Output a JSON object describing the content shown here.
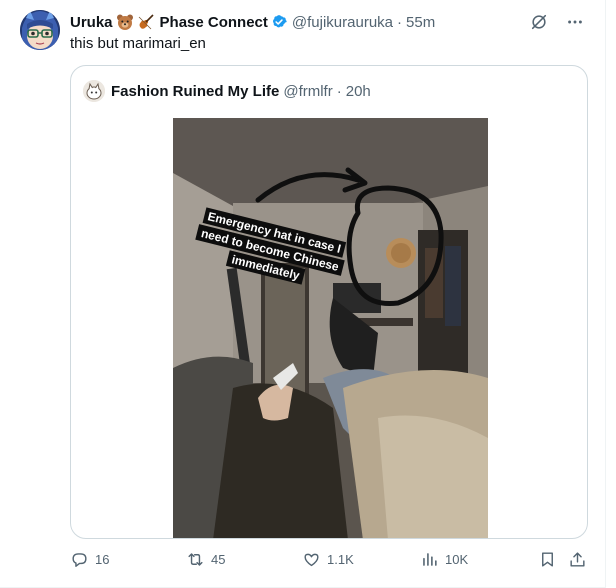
{
  "tweet": {
    "display_name": "Uruka",
    "affiliation": "Phase Connect",
    "handle": "@fujikurauruka",
    "separator": "·",
    "time": "55m",
    "text": "this but marimari_en"
  },
  "quote": {
    "display_name": "Fashion Ruined My Life",
    "handle": "@frmlfr",
    "separator": "·",
    "time": "20h",
    "image_caption_lines": [
      "Emergency hat in case I",
      "need to become Chinese",
      "immediately"
    ]
  },
  "actions": {
    "replies": "16",
    "reposts": "45",
    "likes": "1.1K",
    "views": "10K"
  },
  "colors": {
    "verified": "#1d9bf0",
    "muted_text": "#536471",
    "border": "#cfd9de"
  },
  "icons": [
    "grok-icon",
    "more-icon",
    "verified-badge-icon",
    "reply-icon",
    "repost-icon",
    "like-icon",
    "views-icon",
    "bookmark-icon",
    "share-icon"
  ]
}
